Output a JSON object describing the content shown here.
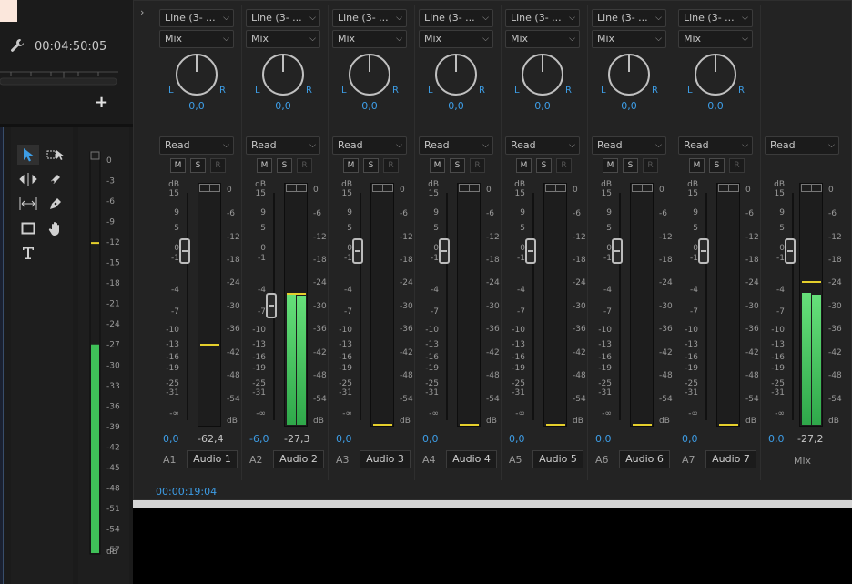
{
  "left_panel": {
    "timecode": "00:04:50:05",
    "tools": [
      "selection-tool",
      "track-select-tool",
      "ripple-edit-tool",
      "razor-tool",
      "slip-tool",
      "pen-tool",
      "rectangle-tool",
      "hand-tool",
      "type-tool"
    ],
    "meter_scale": [
      "0",
      "-3",
      "-6",
      "-9",
      "-12",
      "-15",
      "-18",
      "-21",
      "-24",
      "-27",
      "-30",
      "-33",
      "-36",
      "-39",
      "-42",
      "-45",
      "-48",
      "-51",
      "-54",
      "-57",
      "dB"
    ],
    "meter_level": -27,
    "meter_peak_hold": -12
  },
  "mixer": {
    "timecode": "00:00:19:04",
    "scale_left": [
      "dB",
      "15",
      "9",
      "5",
      "0",
      "-1",
      "-4",
      "-7",
      "-10",
      "-13",
      "-16",
      "-19",
      "-25",
      "-31",
      "-∞"
    ],
    "scale_right": [
      "0",
      "-6",
      "-12",
      "-18",
      "-24",
      "-30",
      "-36",
      "-42",
      "-48",
      "-54",
      "dB"
    ],
    "pan_l": "L",
    "pan_r": "R",
    "btn_m": "M",
    "btn_s": "S",
    "btn_r": "R",
    "tracks": [
      {
        "input": "Line (3- ...",
        "mode": "Mix",
        "pan": "0,0",
        "automation": "Read",
        "id": "A1",
        "name": "Audio 1",
        "volume": "0,0",
        "peak": "-62,4",
        "level": -100,
        "hold": -40.5
      },
      {
        "input": "Line (3- ...",
        "mode": "Mix",
        "pan": "0,0",
        "automation": "Read",
        "id": "A2",
        "name": "Audio 2",
        "volume": "-6,0",
        "peak": "-27,3",
        "level": -27.3,
        "hold": -27
      },
      {
        "input": "Line (3- ...",
        "mode": "Mix",
        "pan": "0,0",
        "automation": "Read",
        "id": "A3",
        "name": "Audio 3",
        "volume": "0,0",
        "peak": "",
        "level": -100,
        "hold": -60
      },
      {
        "input": "Line (3- ...",
        "mode": "Mix",
        "pan": "0,0",
        "automation": "Read",
        "id": "A4",
        "name": "Audio 4",
        "volume": "0,0",
        "peak": "",
        "level": -100,
        "hold": -60
      },
      {
        "input": "Line (3- ...",
        "mode": "Mix",
        "pan": "0,0",
        "automation": "Read",
        "id": "A5",
        "name": "Audio 5",
        "volume": "0,0",
        "peak": "",
        "level": -100,
        "hold": -60
      },
      {
        "input": "Line (3- ...",
        "mode": "Mix",
        "pan": "0,0",
        "automation": "Read",
        "id": "A6",
        "name": "Audio 6",
        "volume": "0,0",
        "peak": "",
        "level": -100,
        "hold": -60
      },
      {
        "input": "Line (3- ...",
        "mode": "Mix",
        "pan": "0,0",
        "automation": "Read",
        "id": "A7",
        "name": "Audio 7",
        "volume": "0,0",
        "peak": "",
        "level": -100,
        "hold": -60
      }
    ],
    "master": {
      "automation": "Read",
      "name": "Mix",
      "volume": "0,0",
      "peak": "-27,2",
      "level": -27.2,
      "hold": -24
    }
  }
}
